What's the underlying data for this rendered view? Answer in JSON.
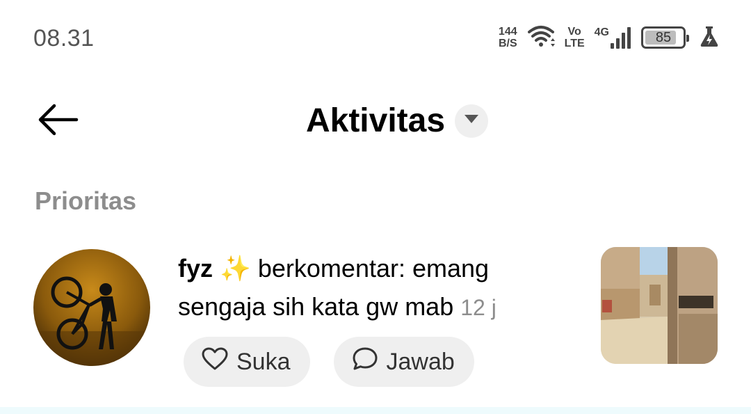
{
  "status_bar": {
    "time": "08.31",
    "net_speed_value": "144",
    "net_speed_unit": "B/S",
    "volte_top": "Vo",
    "volte_bottom": "LTE",
    "network_type": "4G",
    "battery_percent": "85",
    "battery_level": 0.85,
    "icons": [
      "wifi-icon",
      "signal-icon",
      "battery-icon",
      "battery-saver-icon"
    ]
  },
  "header": {
    "back_icon": "arrow-left-icon",
    "title": "Aktivitas",
    "dropdown_icon": "chevron-down-icon"
  },
  "section": {
    "label": "Prioritas"
  },
  "notification": {
    "username": "fyz",
    "emoji": "✨",
    "action_text": "berkomentar: emang sengaja sih kata gw mab",
    "timestamp": "12 j",
    "like_label": "Suka",
    "like_icon": "heart-icon",
    "reply_label": "Jawab",
    "reply_icon": "speech-bubble-icon"
  },
  "colors": {
    "secondary_text": "#8d8d8d",
    "pill_bg": "#efefef"
  }
}
